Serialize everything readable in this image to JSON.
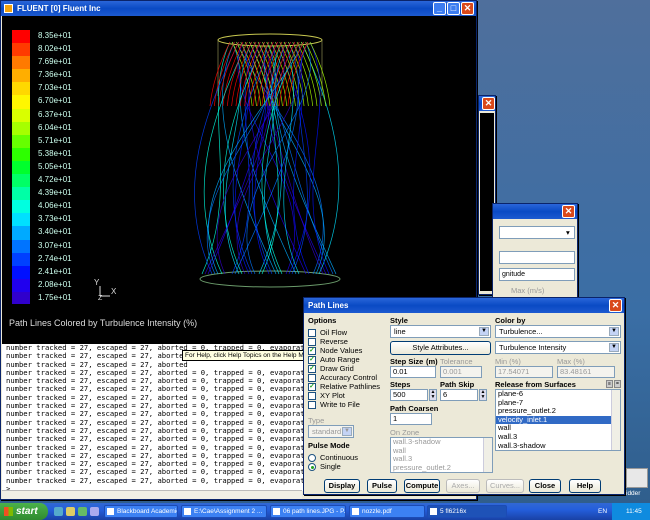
{
  "fluent_window": {
    "title": "FLUENT [0] Fluent Inc",
    "legend": [
      "8.35e+01",
      "8.02e+01",
      "7.69e+01",
      "7.36e+01",
      "7.03e+01",
      "6.70e+01",
      "6.37e+01",
      "6.04e+01",
      "5.71e+01",
      "5.38e+01",
      "5.05e+01",
      "4.72e+01",
      "4.39e+01",
      "4.06e+01",
      "3.73e+01",
      "3.40e+01",
      "3.07e+01",
      "2.74e+01",
      "2.41e+01",
      "2.08e+01",
      "1.75e+01"
    ],
    "legend_colors": [
      "#ff0000",
      "#ff3a00",
      "#ff7a00",
      "#ffae00",
      "#ffd800",
      "#fff700",
      "#d9ff00",
      "#a6ff00",
      "#66ff00",
      "#2dff00",
      "#00ff2d",
      "#00ff66",
      "#00ffa6",
      "#00ffe0",
      "#00e0ff",
      "#00aaff",
      "#0074ff",
      "#0040ff",
      "#0010ff",
      "#2000ee",
      "#3000cc"
    ],
    "axis_labels": {
      "y": "Y",
      "x": "X",
      "z": "Z"
    },
    "caption": "Path Lines Colored by Turbulence Intensity (%)"
  },
  "console": {
    "lines": [
      "number tracked = 27, escaped = 27, aborted = 0, trapped = 0, evaporated",
      "number tracked = 27, escaped = 27, aborted",
      "number tracked = 27, escaped = 27, aborted",
      "number tracked = 27, escaped = 27, aborted = 0, trapped = 0, evaporated",
      "number tracked = 27, escaped = 27, aborted = 0, trapped = 0, evaporated",
      "number tracked = 27, escaped = 27, aborted = 0, trapped = 0, evaporated",
      "number tracked = 27, escaped = 27, aborted = 0, trapped = 0, evaporated",
      "number tracked = 27, escaped = 27, aborted = 0, trapped = 0, evaporated",
      "number tracked = 27, escaped = 27, aborted = 0, trapped = 0, evaporated",
      "number tracked = 27, escaped = 27, aborted = 0, trapped = 0, evaporated",
      "number tracked = 27, escaped = 27, aborted = 0, trapped = 0, evaporated",
      "number tracked = 27, escaped = 27, aborted = 0, trapped = 0, evaporated",
      "number tracked = 27, escaped = 27, aborted = 0, trapped = 0, evaporated",
      "number tracked = 27, escaped = 27, aborted = 0, trapped = 0, evaporated",
      "number tracked = 27, escaped = 27, aborted = 0, trapped = 0, evaporated",
      "number tracked = 27, escaped = 27, aborted = 0, trapped = 0, evaporated",
      "number tracked = 27, escaped = 27, aborted = 0, trapped = 0, evaporated",
      ">"
    ],
    "tooltip": "For Help, click Help Topics on the Help Menu."
  },
  "background_dialog": {
    "field_label": "gnitude",
    "max_label": "Max (m/s)"
  },
  "path_lines": {
    "title": "Path Lines",
    "options": {
      "header": "Options",
      "items": [
        {
          "label": "Oil Flow",
          "checked": false
        },
        {
          "label": "Reverse",
          "checked": false
        },
        {
          "label": "Node Values",
          "checked": true
        },
        {
          "label": "Auto Range",
          "checked": true
        },
        {
          "label": "Draw Grid",
          "checked": true
        },
        {
          "label": "Accuracy Control",
          "checked": false
        },
        {
          "label": "Relative Pathlines",
          "checked": true
        },
        {
          "label": "XY Plot",
          "checked": false
        },
        {
          "label": "Write to File",
          "checked": false
        }
      ]
    },
    "type_label": "Type",
    "type_value": "standard",
    "pulse_mode": {
      "header": "Pulse Mode",
      "items": [
        {
          "label": "Continuous",
          "selected": false
        },
        {
          "label": "Single",
          "selected": true
        }
      ]
    },
    "style": {
      "header": "Style",
      "value": "line",
      "attributes_button": "Style Attributes...",
      "step_size_label": "Step Size",
      "step_size_unit": "(m)",
      "step_size_value": "0.01",
      "tolerance_label": "Tolerance",
      "tolerance_value": "0.001",
      "steps_label": "Steps",
      "steps_value": "500",
      "path_skip_label": "Path Skip",
      "path_skip_value": "6",
      "path_coarsen_label": "Path Coarsen",
      "path_coarsen_value": "1",
      "on_zone_label": "On Zone",
      "on_zone_items": [
        "wall.3-shadow",
        "wall",
        "wall.3",
        "pressure_outlet.2"
      ]
    },
    "color_by": {
      "header": "Color by",
      "value1": "Turbulence...",
      "value2": "Turbulence Intensity",
      "min_label": "Min (%)",
      "min_value": "17.54071",
      "max_label": "Max (%)",
      "max_value": "83.48161"
    },
    "release": {
      "header": "Release from Surfaces",
      "items": [
        {
          "label": "plane-6",
          "selected": false
        },
        {
          "label": "plane-7",
          "selected": false
        },
        {
          "label": "pressure_outlet.2",
          "selected": false
        },
        {
          "label": "velocity_inlet.1",
          "selected": true
        },
        {
          "label": "wall",
          "selected": false
        },
        {
          "label": "wall.3",
          "selected": false
        },
        {
          "label": "wall.3-shadow",
          "selected": false
        }
      ]
    },
    "buttons": {
      "display": "Display",
      "pulse": "Pulse",
      "compute": "Compute",
      "axes": "Axes...",
      "curves": "Curves...",
      "close": "Close",
      "help": "Help"
    }
  },
  "desktop_label": "idder",
  "taskbar": {
    "start": "start",
    "tasks": [
      "Blackboard Academic ...",
      "E:\\Cae\\Assignment 2 ...",
      "06 path lines.JPG - P...",
      "nozzle.pdf",
      "5 fl6216x"
    ],
    "lang": "EN",
    "clock": "11:45"
  }
}
